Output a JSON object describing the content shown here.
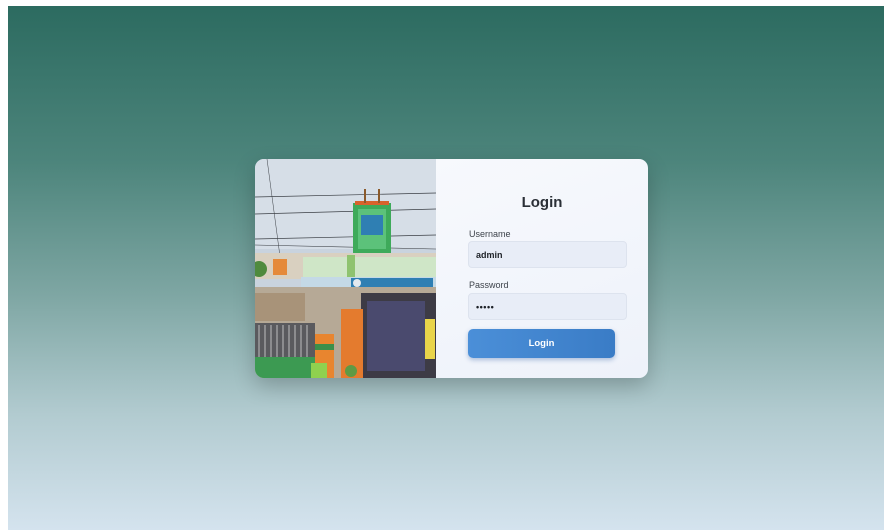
{
  "login": {
    "title": "Login",
    "username_label": "Username",
    "username_value": "admin",
    "password_label": "Password",
    "password_value": "admin",
    "submit_label": "Login"
  },
  "colors": {
    "background_top": "#2c6b60",
    "background_bottom": "#d4e3ee",
    "button": "#3f84cf"
  }
}
